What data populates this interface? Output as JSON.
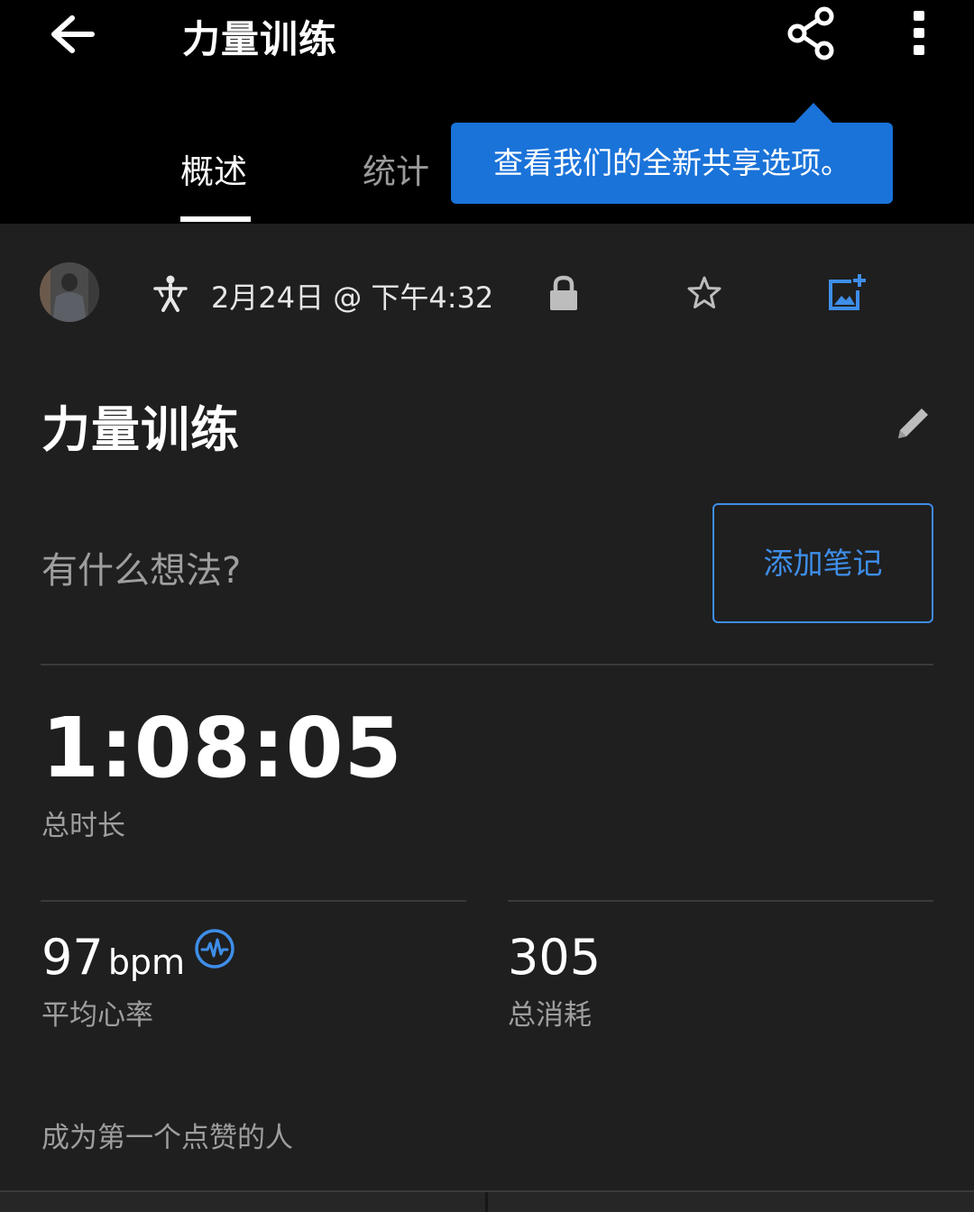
{
  "header": {
    "title": "力量训练",
    "back_icon": "arrow-left-icon",
    "share_icon": "share-icon",
    "more_icon": "more-vertical-icon"
  },
  "tabs": [
    {
      "label": "概述",
      "active": true
    },
    {
      "label": "统计",
      "active": false
    }
  ],
  "tooltip": {
    "text": "查看我们的全新共享选项。",
    "color": "#1a73d9"
  },
  "activity_meta": {
    "date_time": "2月24日 @ 下午4:32",
    "activity_icon": "strength-person-icon",
    "privacy_icon": "lock-icon",
    "favorite_icon": "star-outline-icon",
    "add_photo_icon": "add-photo-icon"
  },
  "activity": {
    "name": "力量训练",
    "edit_icon": "pencil-icon"
  },
  "notes": {
    "prompt": "有什么想法?",
    "button_label": "添加笔记"
  },
  "stats": {
    "duration": {
      "value": "1:08:05",
      "label": "总时长"
    },
    "heart_rate": {
      "value": "97",
      "unit": "bpm",
      "label": "平均心率",
      "icon": "heart-rate-icon"
    },
    "calories": {
      "value": "305",
      "label": "总消耗"
    }
  },
  "social": {
    "like_prompt": "成为第一个点赞的人"
  },
  "colors": {
    "accent": "#3e8ee9",
    "background": "#1f1f1f",
    "header_background": "#000000"
  }
}
